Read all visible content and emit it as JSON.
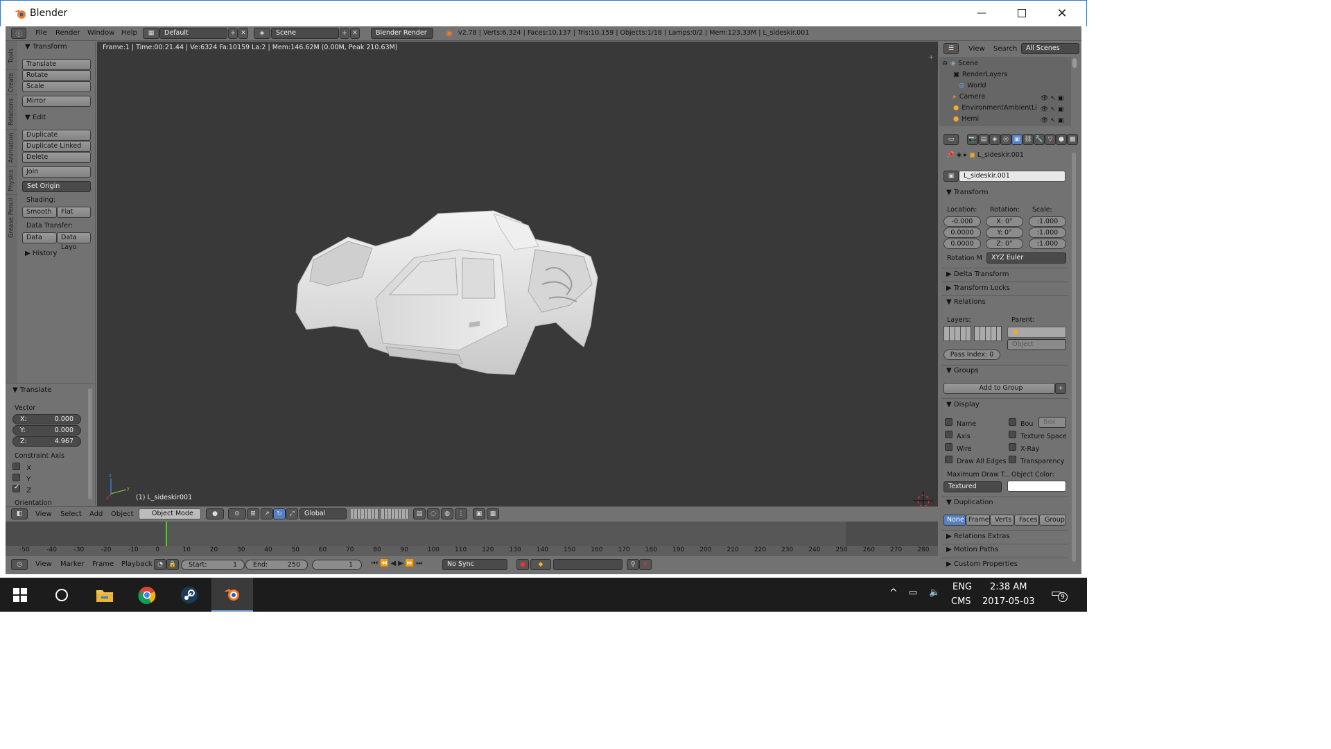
{
  "window": {
    "title": "Blender"
  },
  "topbar": {
    "menus": [
      "File",
      "Render",
      "Window",
      "Help"
    ],
    "layout": "Default",
    "scene": "Scene",
    "engine": "Blender Render",
    "stats": "v2.78 | Verts:6,324 | Faces:10,137 | Tris:10,159 | Objects:1/18 | Lamps:0/2 | Mem:123.33M | L_sideskir.001"
  },
  "toolshelf": {
    "tabs": [
      "Tools",
      "Create",
      "Relations",
      "Animation",
      "Physics",
      "Grease Pencil"
    ],
    "transform_title": "Transform",
    "transform_buttons": [
      "Translate",
      "Rotate",
      "Scale"
    ],
    "mirror": "Mirror",
    "edit_title": "Edit",
    "edit_buttons": [
      "Duplicate",
      "Duplicate Linked",
      "Delete"
    ],
    "join": "Join",
    "set_origin": "Set Origin",
    "shading_label": "Shading:",
    "smooth": "Smooth",
    "flat": "Flat",
    "data_transfer_label": "Data Transfer:",
    "data": "Data",
    "data_layo": "Data Layo",
    "history": "History"
  },
  "operator": {
    "title": "Translate",
    "vector_label": "Vector",
    "x_label": "X:",
    "x": "0.000",
    "y_label": "Y:",
    "y": "0.000",
    "z_label": "Z:",
    "z": "4.967",
    "constraint_label": "Constraint Axis",
    "axes": [
      {
        "label": "X",
        "checked": false
      },
      {
        "label": "Y",
        "checked": false
      },
      {
        "label": "Z",
        "checked": true
      }
    ],
    "orientation": "Orientation"
  },
  "viewport": {
    "info": "Frame:1 | Time:00:21.44 | Ve:6324 Fa:10159 La:2 | Mem:146.62M (0.00M, Peak 210.63M)",
    "object_label": "(1) L_sideskir001"
  },
  "viewport_header": {
    "menus": [
      "View",
      "Select",
      "Add",
      "Object"
    ],
    "mode": "Object Mode",
    "orientation": "Global"
  },
  "timeline": {
    "ticks": [
      "-50",
      "-40",
      "-30",
      "-20",
      "-10",
      "0",
      "10",
      "20",
      "30",
      "40",
      "50",
      "60",
      "70",
      "80",
      "90",
      "100",
      "110",
      "120",
      "130",
      "140",
      "150",
      "160",
      "170",
      "180",
      "190",
      "200",
      "210",
      "220",
      "230",
      "240",
      "250",
      "260",
      "270",
      "280"
    ],
    "menus": [
      "View",
      "Marker",
      "Frame",
      "Playback"
    ],
    "start_label": "Start:",
    "start": "1",
    "end_label": "End:",
    "end": "250",
    "current": "1",
    "sync": "No Sync"
  },
  "outliner": {
    "menus": [
      "View",
      "Search"
    ],
    "filter": "All Scenes",
    "items": [
      "Scene",
      "RenderLayers",
      "World",
      "Camera",
      "EnvironmentAmbientLi",
      "Hemi"
    ]
  },
  "properties": {
    "breadcrumb": "L_sideskir.001",
    "object_name": "L_sideskir.001",
    "transform_title": "Transform",
    "location_label": "Location:",
    "rotation_label": "Rotation:",
    "scale_label": "Scale:",
    "location": [
      "-0.000",
      "0.0000",
      "0.0000"
    ],
    "rotation_x": "X:",
    "rotation_y": "Y:",
    "rotation_z": "Z:",
    "rotation": [
      "0°",
      "0°",
      "0°"
    ],
    "scale": [
      ":1.000",
      ":1.000",
      ":1.000"
    ],
    "rotation_mode_label": "Rotation M",
    "rotation_mode": "XYZ Euler",
    "delta_transform": "Delta Transform",
    "transform_locks": "Transform Locks",
    "relations_title": "Relations",
    "layers_label": "Layers:",
    "parent_label": "Parent:",
    "parent_type": "Object",
    "pass_index_label": "Pass Index:",
    "pass_index": "0",
    "groups_title": "Groups",
    "add_to_group": "Add to Group",
    "display_title": "Display",
    "display_left": [
      "Name",
      "Axis",
      "Wire",
      "Draw All Edges"
    ],
    "display_right": [
      "Bou",
      "Texture Space",
      "X-Ray",
      "Transparency"
    ],
    "bounds_type": "Box",
    "max_draw_label": "Maximum Draw T...",
    "object_color_label": "Object Color:",
    "max_draw": "Textured",
    "duplication_title": "Duplication",
    "duplication_options": [
      "None",
      "Frames",
      "Verts",
      "Faces",
      "Group"
    ],
    "relations_extras": "Relations Extras",
    "motion_paths": "Motion Paths",
    "custom_properties": "Custom Properties"
  },
  "taskbar": {
    "lang": "ENG",
    "ime": "CMS",
    "time": "2:38 AM",
    "date": "2017-05-03",
    "notifications": "9"
  },
  "colors": {
    "accent": "#5680c2",
    "blender_orange": "#f5792a",
    "viewport_bg": "#393939"
  }
}
